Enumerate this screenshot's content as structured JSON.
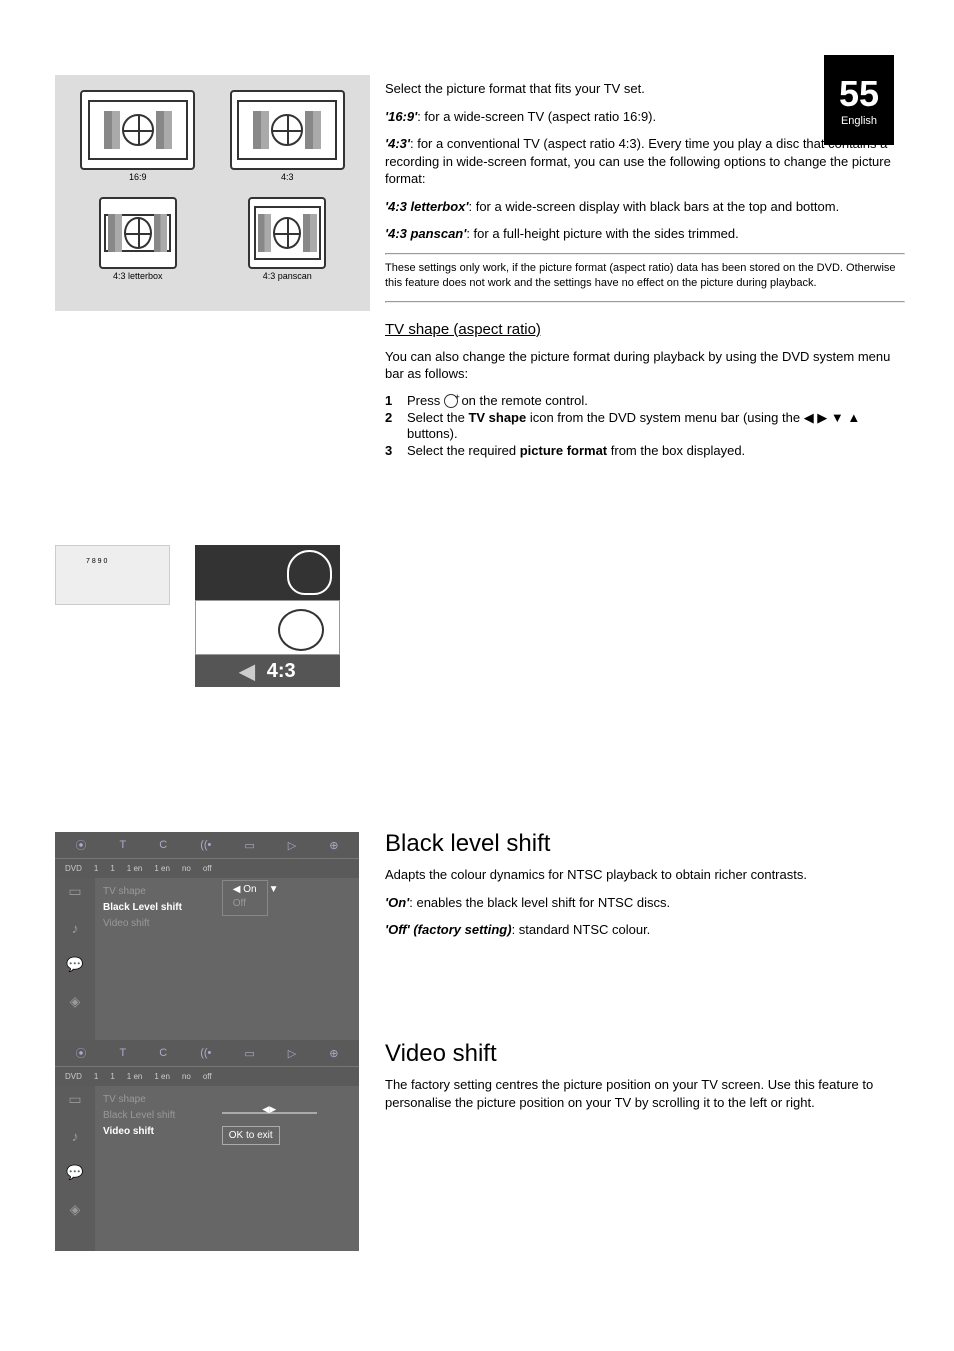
{
  "page_number_big": "55",
  "page_number_small": "English",
  "tv_diagram_labels": {
    "top_left": "16:9",
    "top_right": "4:3",
    "bottom_left": "4:3 letterbox",
    "bottom_right": "4:3 panscan"
  },
  "aspect_preview": "4:3",
  "right_text": {
    "p1": "Select the picture format that fits your TV set.",
    "o1_label": "'16:9'",
    "o1_text": ": for a wide-screen TV (aspect ratio 16:9).",
    "o2_label": "'4:3'",
    "o2_text": ": for a conventional TV (aspect ratio 4:3). Every time you play a disc that contains a recording in wide-screen format, you can use the following options to change the picture format:",
    "o3_label": "'4:3 letterbox'",
    "o3_text": ": for a wide-screen display with black bars at the top and bottom.",
    "o4_label": "'4:3 panscan'",
    "o4_text": ": for a full-height picture with the sides trimmed.",
    "hr_note": "These settings only work, if the picture format (aspect ratio) data has been stored on the DVD. Otherwise this feature does not work and the settings have no effect on the picture during playback.",
    "aspect_head": "TV shape (aspect ratio)",
    "aspect_intro": "You can also change the picture format during playback by using the DVD system menu bar as follows:",
    "step1": "Press ",
    "step1b": " on the remote control.",
    "step2a": "Select the ",
    "step2b": "TV shape",
    "step2c": " icon from the DVD system menu bar (using the ",
    "step2d": " buttons).",
    "step3a": "Select the required ",
    "step3b": "picture format",
    "step3c": " from the box displayed.",
    "blacklevel_head": "Black level shift",
    "blacklevel_body": "Adapts the colour dynamics for NTSC playback to obtain richer contrasts.",
    "bl_o1_label": "'On'",
    "bl_o1_text": ": enables the black level shift for NTSC discs.",
    "bl_o2_label": "'Off' (factory setting)",
    "bl_o2_text": ": standard NTSC colour.",
    "videoshift_head": "Video shift",
    "videoshift_body": "The factory setting centres the picture position on your TV screen. Use this feature to personalise the picture position on your TV by scrolling it to the left or right."
  },
  "menu_top_icons": [
    "⦿",
    "T",
    "C",
    "((•",
    "▭",
    "▷",
    "⊕"
  ],
  "menu_dvd_row": [
    "DVD",
    "1",
    "1",
    "1 en",
    "1 en",
    "no",
    "off"
  ],
  "menu1": {
    "items": [
      "TV shape",
      "Black Level shift",
      "Video shift"
    ],
    "highlight_index": 1,
    "options": [
      "On",
      "Off"
    ],
    "selected_option_index": 0
  },
  "menu2": {
    "items": [
      "TV shape",
      "Black Level shift",
      "Video shift"
    ],
    "highlight_index": 2,
    "ok_label": "OK to exit"
  }
}
